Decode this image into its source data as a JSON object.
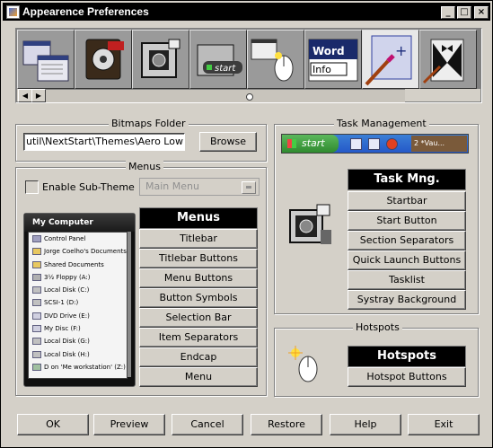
{
  "window": {
    "title": "Appearence Preferences",
    "controls": {
      "minimize": "_",
      "maximize": "□",
      "close": "×"
    }
  },
  "icon_strip": {
    "tiles": [
      {
        "name": "menus-tile",
        "icon": "menu-windows-icon",
        "selected": false
      },
      {
        "name": "film-tile",
        "icon": "film-reel-icon",
        "selected": false
      },
      {
        "name": "bitmaps-tile",
        "icon": "camera-icon",
        "selected": false
      },
      {
        "name": "startbar-tile",
        "icon": "start-button-icon",
        "selected": false
      },
      {
        "name": "hotspots-tile",
        "icon": "mouse-click-icon",
        "selected": false
      },
      {
        "name": "fonts-tile",
        "icon": "word-info-icon",
        "selected": false,
        "text1": "Word",
        "text2": "Info"
      },
      {
        "name": "skins-tile",
        "icon": "window-paint-icon",
        "selected": true
      },
      {
        "name": "tuxedo-tile",
        "icon": "tuxedo-icon",
        "selected": false
      }
    ],
    "scroll": {
      "left_arrow": "◀",
      "right_arrow": "▶"
    }
  },
  "bitmaps_folder": {
    "label": "Bitmaps Folder",
    "path": "util\\NextStart\\Themes\\Aero LowRes\\",
    "browse_label": "Browse"
  },
  "task_management": {
    "label": "Task Management",
    "preview": {
      "start_text": "start",
      "tray_text": "2 *Vau..."
    },
    "header": "Task Mng.",
    "items": [
      "Startbar",
      "Start Button",
      "Section Separators",
      "Quick Launch Buttons",
      "Tasklist",
      "Systray Background"
    ]
  },
  "menus": {
    "label": "Menus",
    "sub_theme_label": "Enable Sub-Theme",
    "sub_theme_checked": false,
    "sub_theme_select": "Main Menu",
    "preview": {
      "title": "My Computer",
      "items": [
        "Control Panel",
        "Jorge Coelho's Documents",
        "Shared Documents",
        "3½ Floppy (A:)",
        "Local Disk (C:)",
        "SCSI-1 (D:)",
        "DVD Drive (E:)",
        "My Disc (F:)",
        "Local Disk (G:)",
        "Local Disk (H:)",
        "D on 'Me workstation' (Z:)"
      ]
    },
    "header": "Menus",
    "items": [
      "Titlebar",
      "Titlebar Buttons",
      "Menu Buttons",
      "Button Symbols",
      "Selection Bar",
      "Item Separators",
      "Endcap",
      "Menu"
    ]
  },
  "hotspots": {
    "label": "Hotspots",
    "header": "Hotspots",
    "items": [
      "Hotspot Buttons"
    ]
  },
  "bottom_buttons": [
    "OK",
    "Preview",
    "Cancel",
    "Restore",
    "Help",
    "Exit"
  ]
}
